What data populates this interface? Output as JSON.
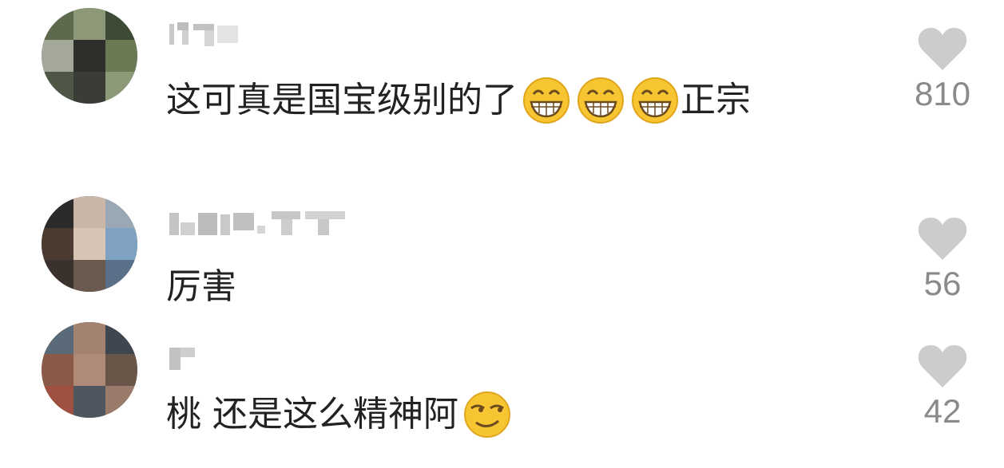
{
  "comments": [
    {
      "text": "这可真是国宝级别的了",
      "emoji_after": [
        "grin-emoji",
        "grin-emoji",
        "grin-emoji"
      ],
      "suffix": "正宗",
      "likes": "810",
      "avatar_colors": [
        "#6b7a55",
        "#3d4a35",
        "#8c9a78",
        "#2e2f2a",
        "#a3a89a"
      ]
    },
    {
      "text": "厉害",
      "emoji_after": [],
      "suffix": "",
      "likes": "56",
      "avatar_colors": [
        "#4a3a30",
        "#7fa2c2",
        "#c9b6a8",
        "#2d2a2a",
        "#9aa7b5"
      ]
    },
    {
      "text": "桃 还是这么精神阿",
      "emoji_after": [
        "smirk-emoji"
      ],
      "suffix": "",
      "likes": "42",
      "avatar_colors": [
        "#8a5a48",
        "#5a6a78",
        "#a38270",
        "#3e4650",
        "#b08a78"
      ]
    }
  ],
  "icons": {
    "like": "heart-icon"
  },
  "colors": {
    "text": "#222222",
    "count": "#8a8a8a",
    "heart": "#cccccc",
    "emoji": "#f7c531"
  }
}
